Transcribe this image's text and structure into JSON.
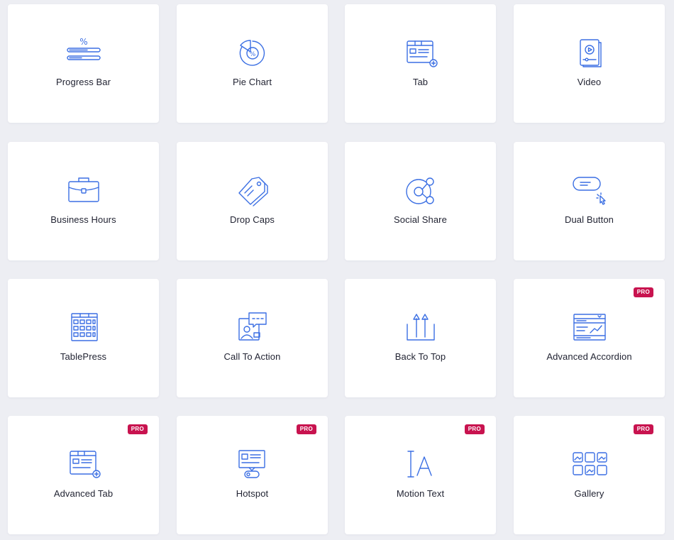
{
  "pro_badge": "PRO",
  "colors": {
    "icon": "#3b6fe3",
    "pro_badge": "#c8134f",
    "background": "#edeef3",
    "card": "#ffffff"
  },
  "widgets": [
    {
      "label": "Progress Bar",
      "icon": "progress-bar-icon",
      "pro": false
    },
    {
      "label": "Pie Chart",
      "icon": "pie-chart-icon",
      "pro": false
    },
    {
      "label": "Tab",
      "icon": "tab-icon",
      "pro": false
    },
    {
      "label": "Video",
      "icon": "video-icon",
      "pro": false
    },
    {
      "label": "Business Hours",
      "icon": "briefcase-icon",
      "pro": false
    },
    {
      "label": "Drop Caps",
      "icon": "price-tag-icon",
      "pro": false
    },
    {
      "label": "Social Share",
      "icon": "share-icon",
      "pro": false
    },
    {
      "label": "Dual Button",
      "icon": "dual-button-icon",
      "pro": false
    },
    {
      "label": "TablePress",
      "icon": "table-icon",
      "pro": false
    },
    {
      "label": "Call To Action",
      "icon": "call-to-action-icon",
      "pro": false
    },
    {
      "label": "Back To Top",
      "icon": "back-to-top-icon",
      "pro": false
    },
    {
      "label": "Advanced Accordion",
      "icon": "accordion-icon",
      "pro": true
    },
    {
      "label": "Advanced Tab",
      "icon": "advanced-tab-icon",
      "pro": true
    },
    {
      "label": "Hotspot",
      "icon": "hotspot-icon",
      "pro": true
    },
    {
      "label": "Motion Text",
      "icon": "motion-text-icon",
      "pro": true
    },
    {
      "label": "Gallery",
      "icon": "gallery-icon",
      "pro": true
    }
  ]
}
